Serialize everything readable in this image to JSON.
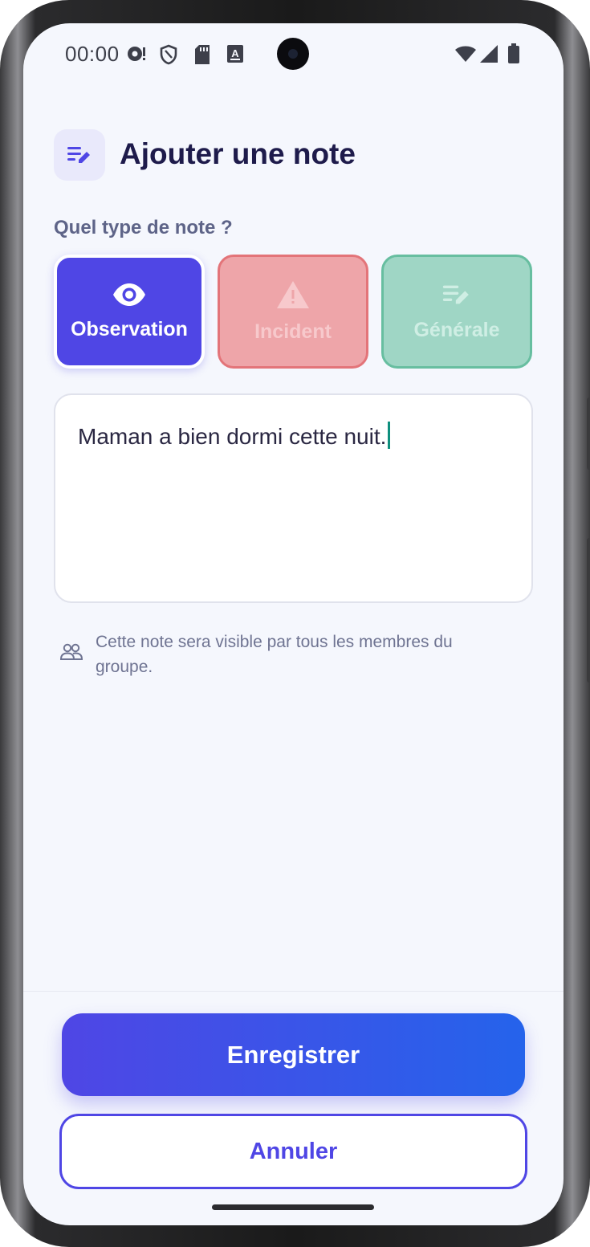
{
  "status_bar": {
    "time": "00:00",
    "icons": [
      "sync-alert-icon",
      "shield-icon",
      "sd-card-icon",
      "keyboard-a-icon",
      "wifi-icon",
      "signal-icon",
      "battery-icon"
    ]
  },
  "header": {
    "icon": "edit-note-icon",
    "title": "Ajouter une note"
  },
  "note_type": {
    "question": "Quel type de note ?",
    "options": [
      {
        "label": "Observation",
        "icon": "eye-icon",
        "selected": true,
        "color": "#4f46e5"
      },
      {
        "label": "Incident",
        "icon": "warning-icon",
        "selected": false,
        "color": "#e37479"
      },
      {
        "label": "Générale",
        "icon": "edit-note-icon",
        "selected": false,
        "color": "#67bea0"
      }
    ]
  },
  "note_input": {
    "value": "Maman a bien dormi cette nuit."
  },
  "visibility": {
    "icon": "group-icon",
    "text": "Cette note sera visible par tous les membres du groupe."
  },
  "actions": {
    "save_label": "Enregistrer",
    "cancel_label": "Annuler"
  },
  "colors": {
    "accent": "#4f46e5",
    "accent_end": "#2563eb",
    "title": "#1e1b4b",
    "background": "#f5f7fd"
  }
}
